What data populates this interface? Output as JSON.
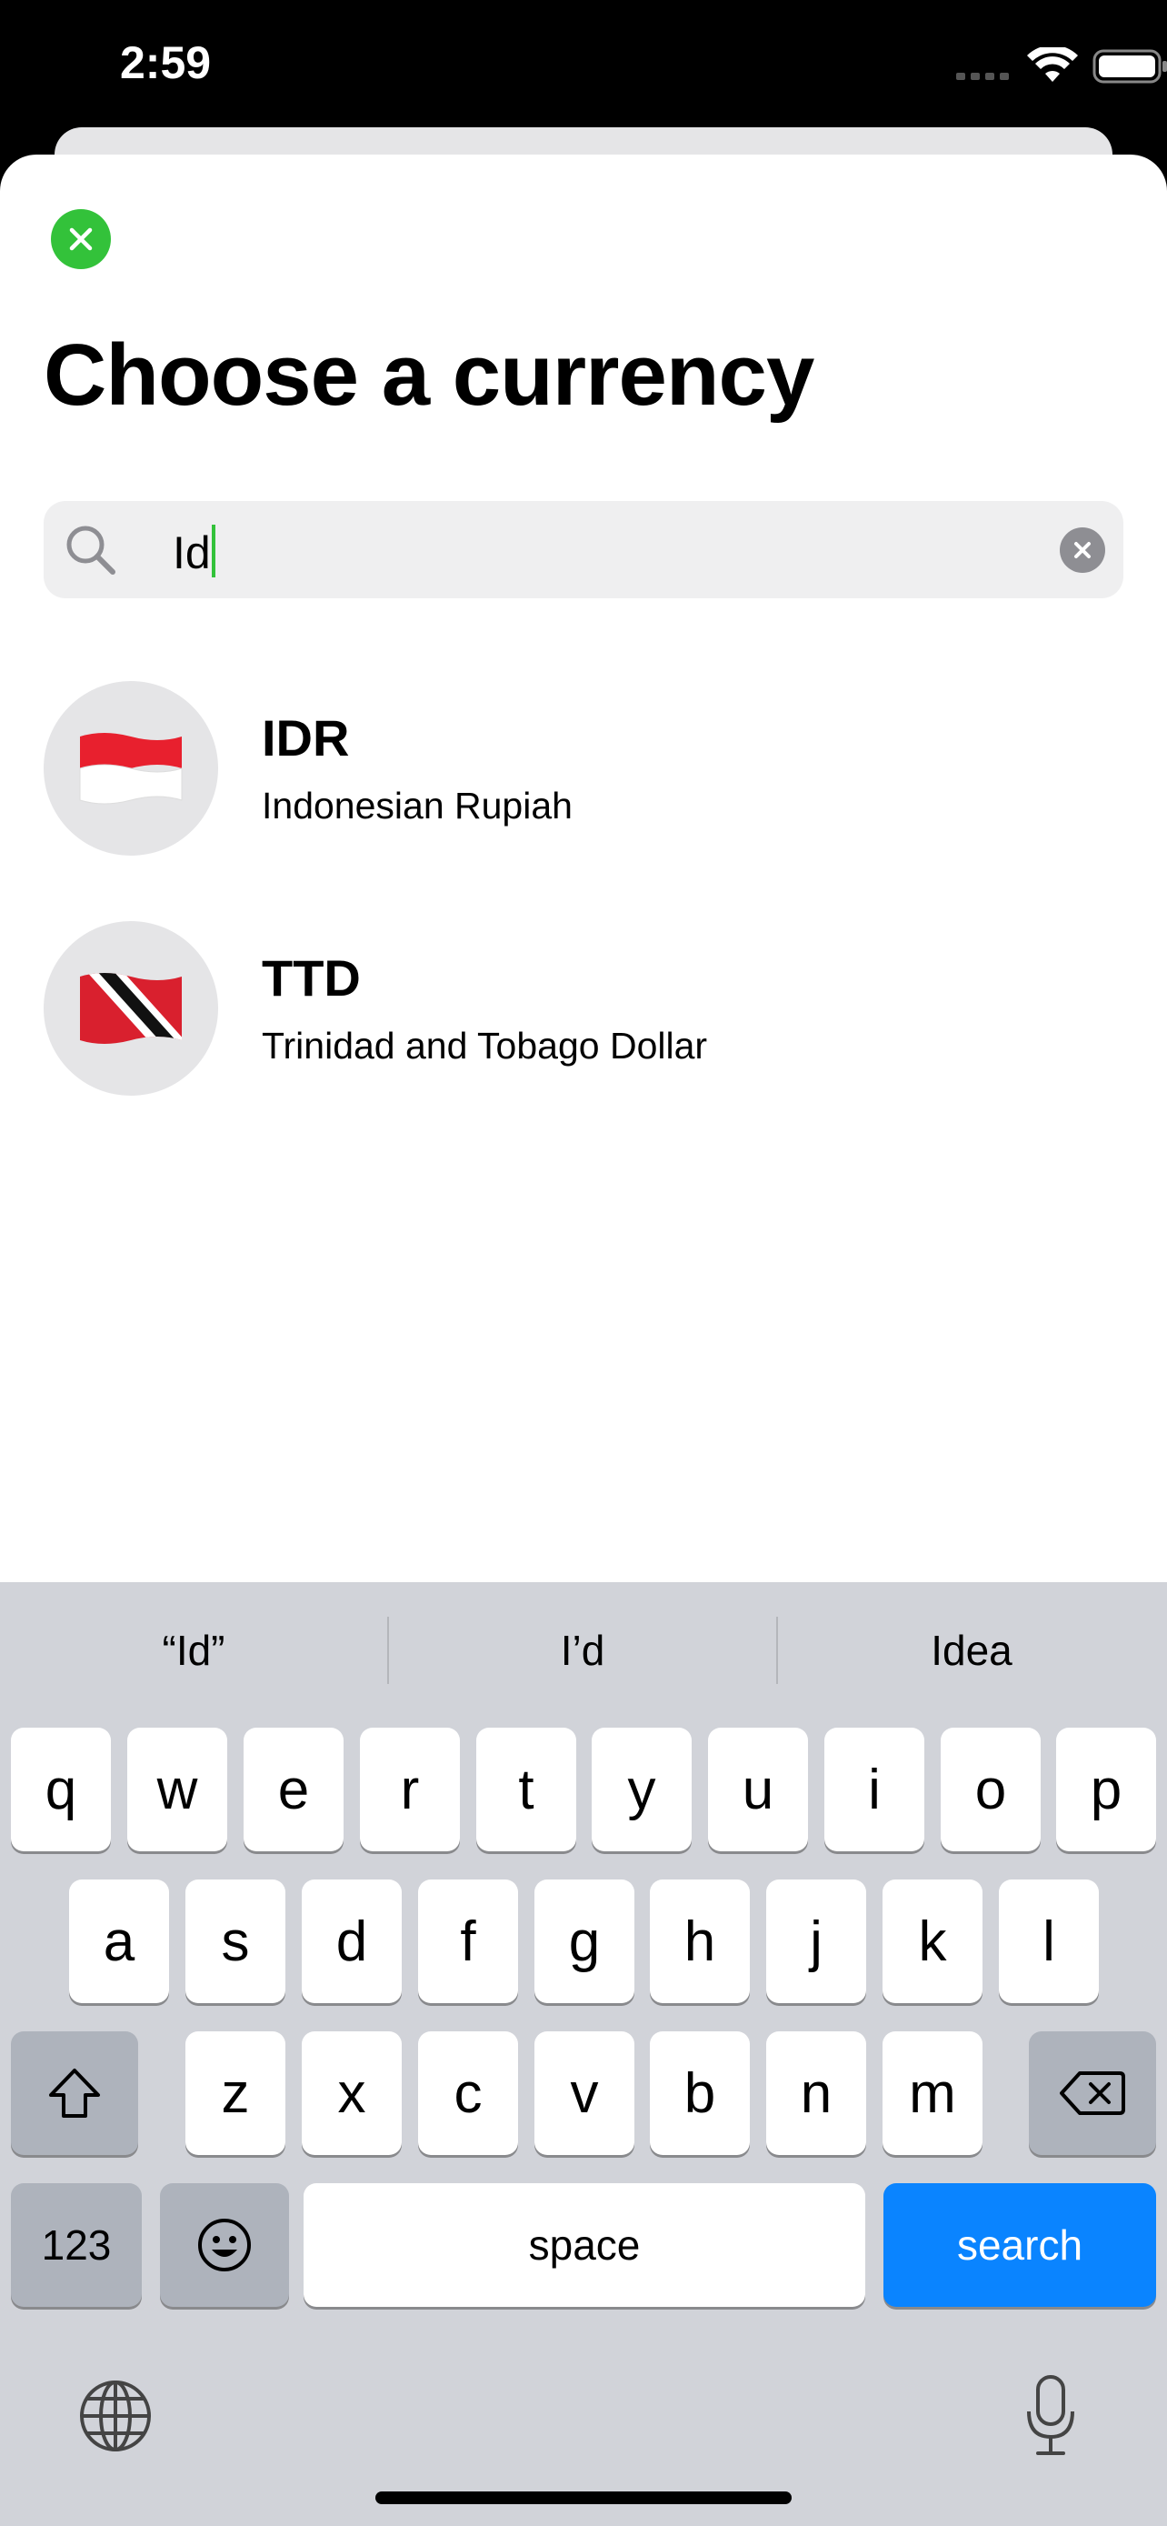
{
  "status_bar": {
    "time": "2:59"
  },
  "sheet": {
    "title": "Choose a currency"
  },
  "search": {
    "value": "Id"
  },
  "results": [
    {
      "code": "IDR",
      "name": "Indonesian Rupiah",
      "flag": "🇮🇩"
    },
    {
      "code": "TTD",
      "name": "Trinidad and Tobago Dollar",
      "flag": "🇹🇹"
    }
  ],
  "suggestions": [
    "“Id”",
    "I’d",
    "Idea"
  ],
  "keyboard": {
    "row1": [
      "q",
      "w",
      "e",
      "r",
      "t",
      "y",
      "u",
      "i",
      "o",
      "p"
    ],
    "row2": [
      "a",
      "s",
      "d",
      "f",
      "g",
      "h",
      "j",
      "k",
      "l"
    ],
    "row3": [
      "z",
      "x",
      "c",
      "v",
      "b",
      "n",
      "m"
    ],
    "numbers_label": "123",
    "space_label": "space",
    "search_label": "search"
  },
  "colors": {
    "accent_green": "#33c23a",
    "keyboard_bg": "#d1d3d9",
    "search_key": "#0a84ff"
  },
  "icons": [
    "signal-icon",
    "wifi-icon",
    "battery-icon",
    "close-icon",
    "search-icon",
    "clear-icon",
    "shift-icon",
    "backspace-icon",
    "emoji-icon",
    "globe-icon",
    "microphone-icon"
  ]
}
